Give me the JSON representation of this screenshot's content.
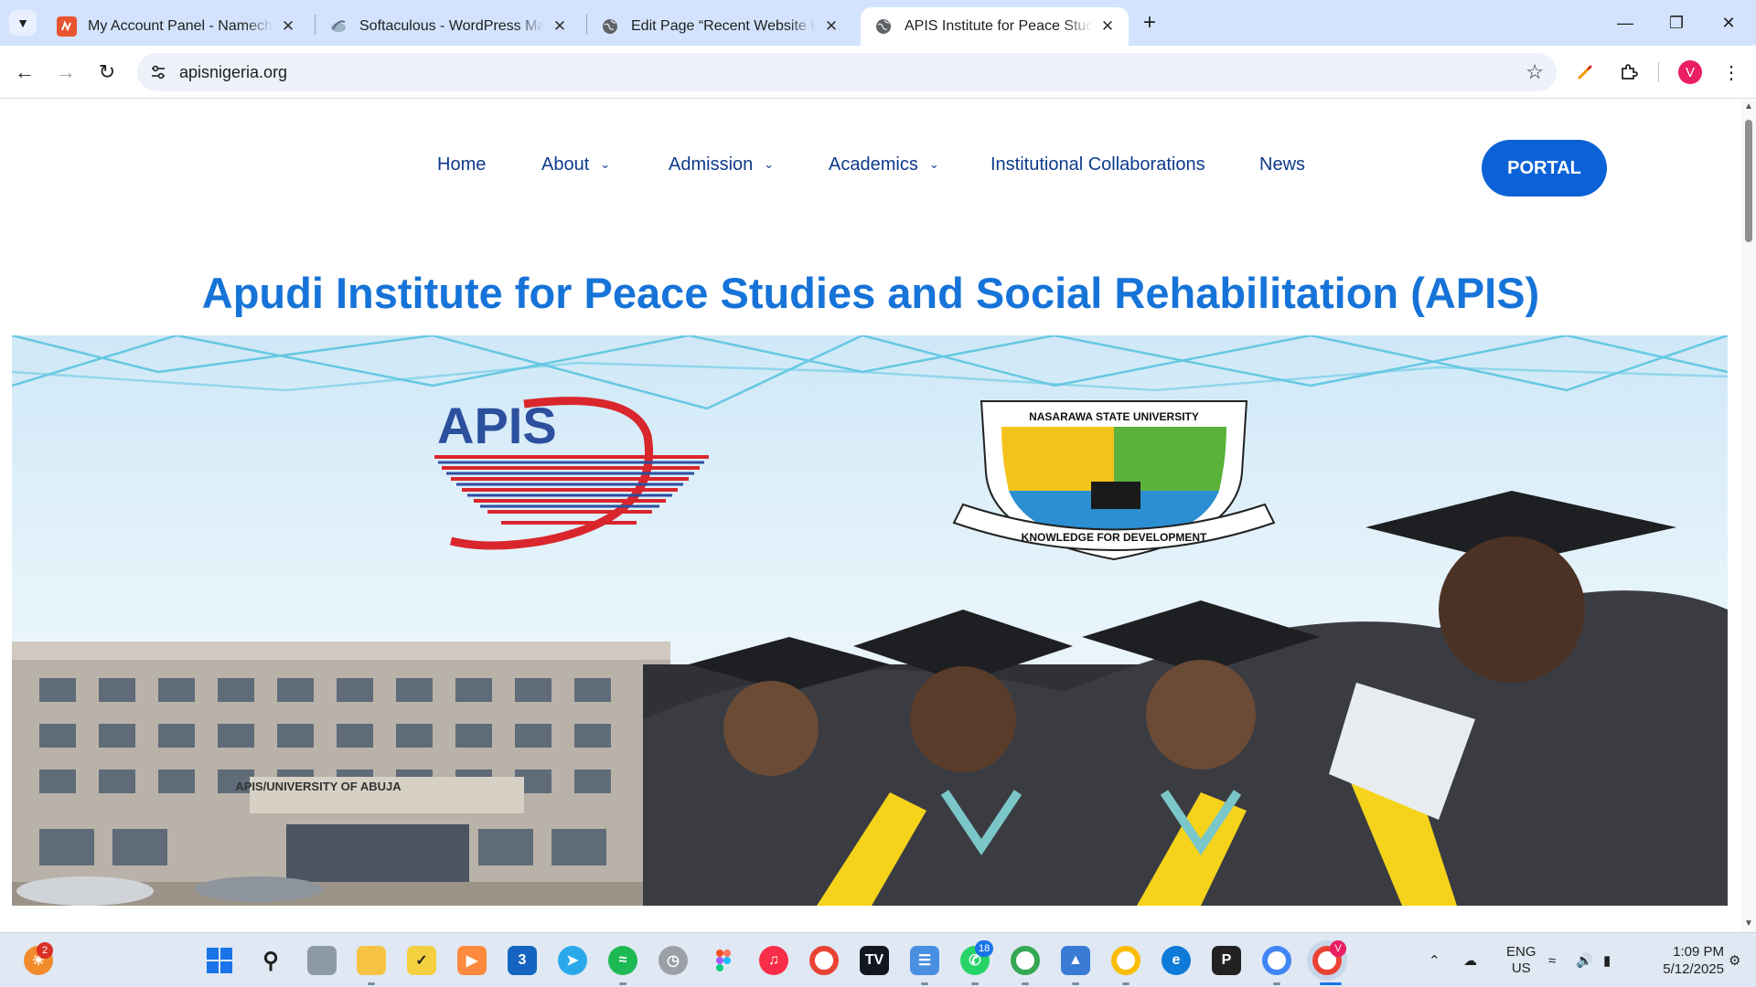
{
  "browser": {
    "tabs": [
      {
        "title": "My Account Panel - Namecheap",
        "favicon": "namecheap-icon",
        "active": false
      },
      {
        "title": "Softaculous - WordPress Manager",
        "favicon": "softaculous-icon",
        "active": false
      },
      {
        "title": "Edit Page “Recent Website Projects”",
        "favicon": "globe-icon",
        "active": false
      },
      {
        "title": "APIS Institute for Peace Studies",
        "favicon": "globe-icon",
        "active": true
      }
    ],
    "url": "apisnigeria.org",
    "profile_initial": "V"
  },
  "site": {
    "nav": [
      {
        "label": "Home",
        "has_dropdown": false
      },
      {
        "label": "About",
        "has_dropdown": true
      },
      {
        "label": "Admission",
        "has_dropdown": true
      },
      {
        "label": "Academics",
        "has_dropdown": true
      },
      {
        "label": "Institutional Collaborations",
        "has_dropdown": false
      },
      {
        "label": "News",
        "has_dropdown": false
      }
    ],
    "portal_label": "PORTAL",
    "title": "Apudi Institute for Peace Studies and Social Rehabilitation (APIS)",
    "hero": {
      "logo_text": "APIS",
      "crest_top": "NASARAWA STATE UNIVERSITY",
      "crest_motto": "KNOWLEDGE FOR DEVELOPMENT",
      "building_sign": "APIS/UNIVERSITY OF ABUJA"
    },
    "colors": {
      "nav_text": "#0e3a8c",
      "accent": "#0b62d6",
      "title": "#1673d8"
    }
  },
  "taskbar": {
    "start_badge": "2",
    "whatsapp_badge": "18",
    "language": "ENG",
    "region": "US",
    "time": "1:09 PM",
    "date": "5/12/2025",
    "chrome_profile_badge": "V"
  }
}
